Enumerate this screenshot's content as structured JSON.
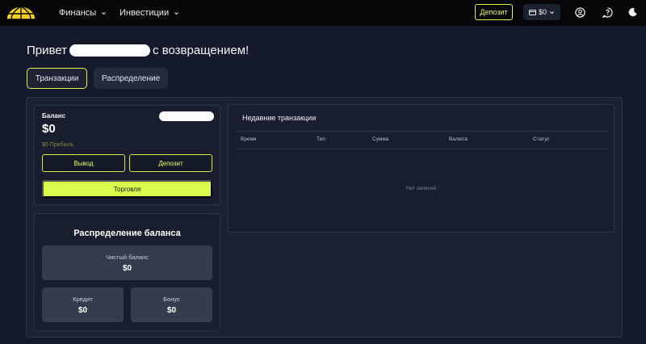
{
  "header": {
    "nav": [
      {
        "label": "Финансы"
      },
      {
        "label": "Инвестиции"
      }
    ],
    "deposit_label": "Депозит",
    "wallet_amount": "$0",
    "icons": [
      "logo-globe-icon",
      "user-icon",
      "help-icon",
      "moon-icon"
    ],
    "accent_color": "#dcfc4c"
  },
  "greeting": {
    "prefix": "Привет",
    "suffix": "с возвращением!"
  },
  "tabs": [
    {
      "label": "Транзакции",
      "active": true
    },
    {
      "label": "Распределение",
      "active": false
    }
  ],
  "balance": {
    "label": "Баланс",
    "amount": "$0",
    "profit": "$0 Прибыль",
    "withdraw_label": "Вывод",
    "deposit_label": "Депозит",
    "trade_label": "Торговля"
  },
  "distribution": {
    "title": "Распределение баланса",
    "net_label": "Чистый баланс",
    "net_value": "$0",
    "credit_label": "Кредит",
    "credit_value": "$0",
    "bonus_label": "Бонус",
    "bonus_value": "$0"
  },
  "transactions": {
    "title": "Недавние транзакции",
    "columns": [
      "Время",
      "Тип",
      "Сумма",
      "Валюта",
      "Статус"
    ],
    "empty_text": "Нет записей"
  }
}
